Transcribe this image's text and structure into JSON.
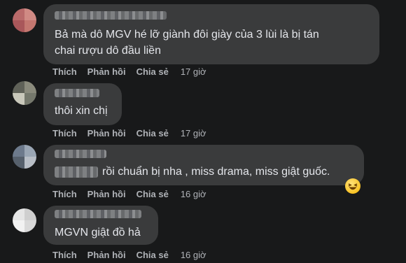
{
  "comments": [
    {
      "text_lines": [
        "Bả mà dô MGV hé lỡ giành đôi giày của 3 lùi là bị tán",
        "chai rượu dô đầu liền"
      ],
      "actions": {
        "like": "Thích",
        "reply": "Phản hồi",
        "share": "Chia sẻ",
        "time": "17 giờ"
      }
    },
    {
      "text_lines": [
        "thôi xin chị"
      ],
      "actions": {
        "like": "Thích",
        "reply": "Phản hồi",
        "share": "Chia sẻ",
        "time": "17 giờ"
      }
    },
    {
      "text_lines": [
        "rồi chuẩn bị nha , miss drama, miss giật guốc."
      ],
      "actions": {
        "like": "Thích",
        "reply": "Phản hồi",
        "share": "Chia sẻ",
        "time": "16 giờ"
      }
    },
    {
      "text_lines": [
        "MGVN giật đồ hả"
      ],
      "actions": {
        "like": "Thích",
        "reply": "Phản hồi",
        "share": "Chia sẻ",
        "time": "16 giờ"
      }
    }
  ],
  "emoji": "laughing-emoji",
  "colors": {
    "background": "#18191a",
    "bubble": "#3a3b3c",
    "text": "#e4e6eb",
    "secondary": "#b0b3b8"
  }
}
